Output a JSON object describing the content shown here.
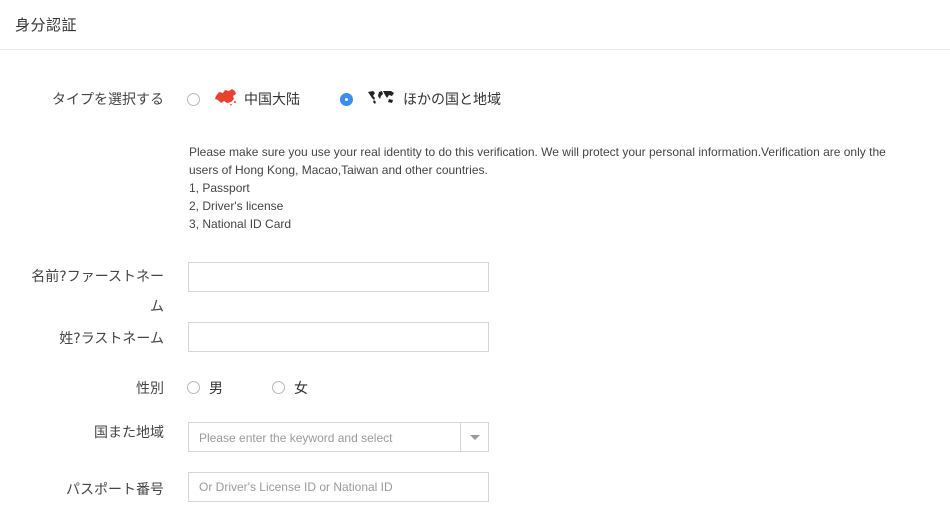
{
  "header": {
    "title": "身分認証"
  },
  "id_type": {
    "label": "タイプを選択する",
    "options": [
      {
        "label": "中国大陆",
        "icon": "china-map-icon",
        "checked": false
      },
      {
        "label": "ほかの国と地域",
        "icon": "world-map-icon",
        "checked": true
      }
    ]
  },
  "notice": {
    "text": "Please make sure you use your real identity to do this verification. We will protect your personal information.Verification are only the users of Hong Kong, Macao,Taiwan and other countries.",
    "items": [
      "1, Passport",
      "2, Driver's license",
      "3, National ID Card"
    ]
  },
  "first_name": {
    "label": "名前?ファーストネーム",
    "value": "",
    "placeholder": ""
  },
  "last_name": {
    "label": "姓?ラストネーム",
    "value": "",
    "placeholder": ""
  },
  "gender": {
    "label": "性別",
    "options": [
      {
        "label": "男",
        "checked": false
      },
      {
        "label": "女",
        "checked": false
      }
    ]
  },
  "region": {
    "label": "国また地域",
    "placeholder": "Please enter the keyword and select"
  },
  "passport": {
    "label": "パスポート番号",
    "value": "",
    "placeholder": "Or Driver's License ID or National ID"
  },
  "colors": {
    "accent": "#3c8ef3",
    "china_flag": "#e8412f",
    "border": "#d6d6d6"
  }
}
